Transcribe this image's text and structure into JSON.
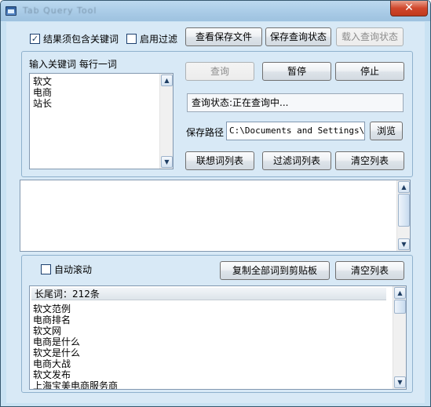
{
  "window": {
    "title": "Tab Query Tool",
    "close_glyph": "✕"
  },
  "options": {
    "must_contain_label": "结果须包含关键词",
    "must_contain_checked": "✓",
    "enable_filter_label": "启用过滤"
  },
  "toolbar": {
    "view_saved": "查看保存文件",
    "save_state": "保存查询状态",
    "load_state": "载入查询状态"
  },
  "keywords": {
    "caption": "输入关键词  每行一词",
    "items": [
      "软文",
      "电商",
      "站长"
    ]
  },
  "query": {
    "query_btn": "查询",
    "pause_btn": "暂停",
    "stop_btn": "停止",
    "status_text": "查询状态:正在查询中...",
    "save_path_label": "保存路径",
    "save_path_value": "C:\\Documents and Settings\\Adm",
    "browse_btn": "浏览",
    "assoc_btn": "联想词列表",
    "filter_btn": "过滤词列表",
    "clear_btn": "清空列表"
  },
  "results": {
    "auto_scroll_label": "自动滚动",
    "copy_all_btn": "复制全部词到剪贴板",
    "clear_btn": "清空列表",
    "header": "长尾词：212条",
    "items": [
      "软文范例",
      "电商排名",
      "软文网",
      "电商是什么",
      "软文是什么",
      "电商大战",
      "软文发布",
      "上海宝美电商服务商"
    ]
  },
  "icons": {
    "scroll_up": "▲",
    "scroll_down": "▼"
  }
}
